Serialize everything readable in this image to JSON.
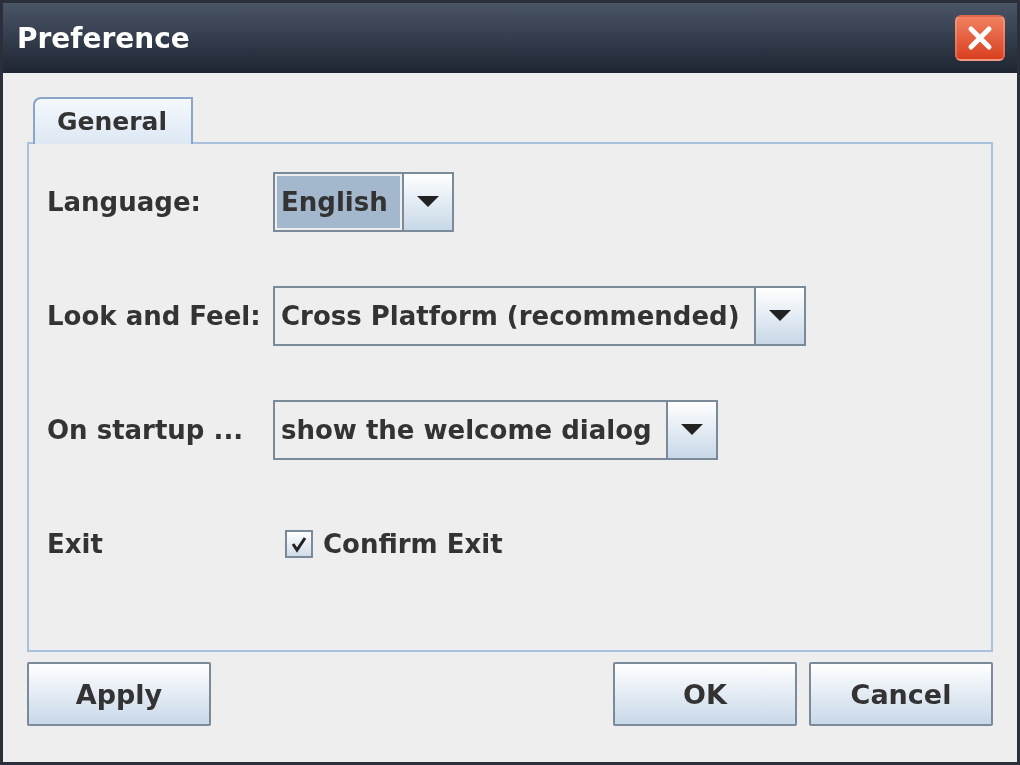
{
  "window": {
    "title": "Preference"
  },
  "tabs": [
    {
      "label": "General",
      "selected": true
    }
  ],
  "settings": [
    {
      "kind": "dropdown",
      "label": "Language:",
      "value": "English",
      "focused": true
    },
    {
      "kind": "dropdown",
      "label": "Look and Feel:",
      "value": "Cross Platform (recommended)",
      "focused": false
    },
    {
      "kind": "dropdown",
      "label": "On startup ...",
      "value": "show the welcome dialog",
      "focused": false
    },
    {
      "kind": "checkbox",
      "label": "Exit",
      "option": "Confirm Exit",
      "checked": true
    }
  ],
  "buttons_left": [
    "Apply"
  ],
  "buttons_right": [
    "OK",
    "Cancel"
  ]
}
